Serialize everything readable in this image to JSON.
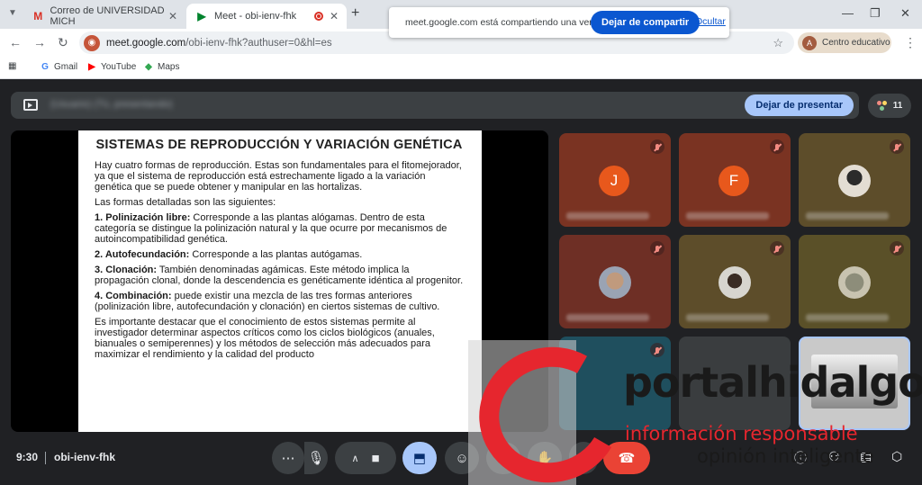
{
  "browser": {
    "tabs": [
      {
        "title": "Correo de UNIVERSIDAD MICH",
        "favicon": "gmail-icon"
      },
      {
        "title": "Meet - obi-ienv-fhk",
        "favicon": "meet-icon"
      }
    ],
    "new_tab": "+",
    "share_bar": {
      "message": "meet.google.com está compartiendo una ventana.",
      "stop_label": "Dejar de compartir",
      "hide_label": "Ocultar"
    },
    "url_host": "meet.google.com",
    "url_path": "/obi-ienv-fhk?authuser=0&hl=es",
    "profile_initial": "A",
    "profile_name": "Centro educativo",
    "bookmarks": [
      {
        "label": "Gmail",
        "icon": "google-icon"
      },
      {
        "label": "YouTube",
        "icon": "youtube-icon"
      },
      {
        "label": "Maps",
        "icon": "maps-icon"
      }
    ]
  },
  "meet": {
    "presenting_name": "(Usuario) (Tú, presentando)",
    "stop_presenting_label": "Dejar de presentar",
    "participant_count": "11",
    "time": "9:30",
    "meeting_code": "obi-ienv-fhk",
    "tiles": [
      {
        "letter": "J",
        "color": "#e8581c"
      },
      {
        "letter": "F",
        "color": "#e8581c"
      }
    ]
  },
  "slide": {
    "title": "SISTEMAS DE REPRODUCCIÓN Y VARIACIÓN GENÉTICA",
    "intro": "Hay cuatro formas de reproducción. Estas son fundamentales para el fitomejorador, ya que el sistema de reproducción está estrechamente ligado a la variación genética que se puede obtener y manipular en las hortalizas.",
    "forms_intro": "Las formas detalladas son las siguientes:",
    "items": [
      {
        "term": "1. Polinización libre:",
        "text": " Corresponde a las plantas alógamas. Dentro de esta categoría se distingue la polinización natural y la que ocurre por mecanismos de autoincompatibilidad genética."
      },
      {
        "term": "2. Autofecundación:",
        "text": " Corresponde a las plantas autógamas."
      },
      {
        "term": "3. Clonación:",
        "text": " También denominadas agámicas. Este método implica la propagación clonal, donde la descendencia es genéticamente idéntica al progenitor."
      },
      {
        "term": "4. Combinación:",
        "text": " puede existir una mezcla de las tres formas anteriores (polinización libre, autofecundación y clonación) en ciertos sistemas de cultivo."
      }
    ],
    "conclusion": "Es importante destacar que el conocimiento de estos sistemas permite al investigador determinar aspectos críticos como los ciclos biológicos (anuales, bianuales o semiperennes) y los métodos de selección más adecuados para maximizar el rendimiento y la calidad del producto"
  },
  "watermark": {
    "brand": "portalhidalgo",
    "tagline1": "información responsable",
    "tagline2": "opinión inteligente"
  }
}
